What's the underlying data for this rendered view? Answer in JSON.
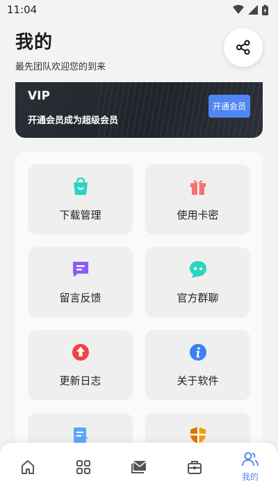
{
  "status_bar": {
    "time": "11:04"
  },
  "header": {
    "title": "我的",
    "subtitle": "最先团队欢迎您的到来"
  },
  "vip": {
    "title": "VIP",
    "desc": "开通会员成为超级会员",
    "button": "开通会员"
  },
  "grid": [
    {
      "label": "下载管理",
      "icon": "shopping-bag-icon",
      "color": "#2dd4bf"
    },
    {
      "label": "使用卡密",
      "icon": "gift-icon",
      "color": "#f87171"
    },
    {
      "label": "留言反馈",
      "icon": "message-icon",
      "color": "#8b5cf6"
    },
    {
      "label": "官方群聊",
      "icon": "chat-bubble-icon",
      "color": "#2dd4bf"
    },
    {
      "label": "更新日志",
      "icon": "upgrade-icon",
      "color": "#ef4444"
    },
    {
      "label": "关于软件",
      "icon": "info-icon",
      "color": "#3b82f6"
    },
    {
      "label": "",
      "icon": "document-icon",
      "color": "#60a5fa"
    },
    {
      "label": "",
      "icon": "shield-icon",
      "color": "#f59e0b"
    }
  ],
  "bottom_nav": {
    "active_label": "我的",
    "accent": "#4f86f1"
  }
}
